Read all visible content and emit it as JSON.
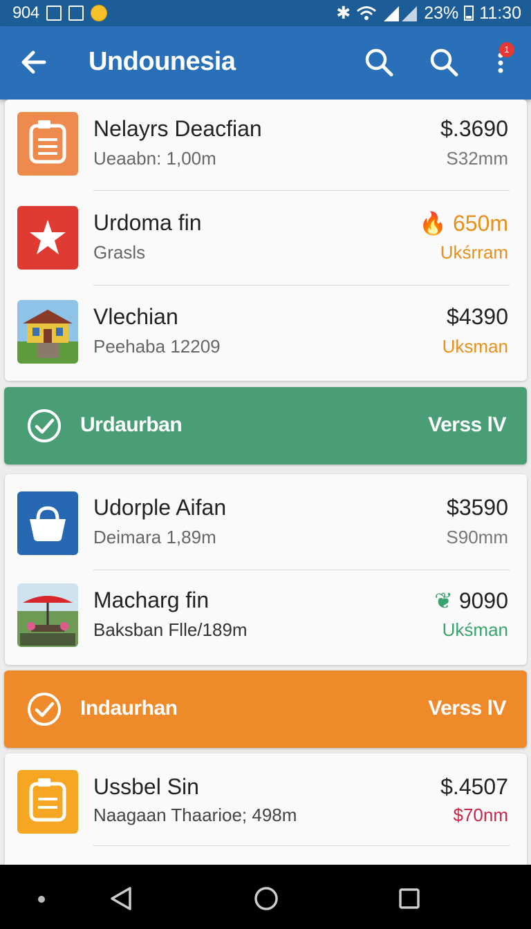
{
  "status_bar": {
    "left_text": "904",
    "battery": "23%",
    "time": "11:30"
  },
  "app_bar": {
    "title": "Undounesia",
    "notification_count": "1"
  },
  "colors": {
    "app_bar": "#2970b9",
    "status_bar": "#1c5c97",
    "green_banner": "#4a9e76",
    "orange_banner": "#ef8a2a",
    "orange_text": "#e9901c",
    "green_text": "#3aa36d",
    "red_text": "#c8274a"
  },
  "group1": {
    "items": [
      {
        "title": "Nelayrs Deacfian",
        "subtitle": "Ueaabn: 1,00m",
        "price": "$.3690",
        "unit": "S32mm",
        "icon": "document-icon"
      },
      {
        "title": "Urdoma fin",
        "subtitle": "Grasls",
        "price": "650m",
        "unit": "Ukśrram",
        "icon": "star-icon"
      },
      {
        "title": "Vlechian",
        "subtitle": "Peehaba 12209",
        "price": "$4390",
        "unit": "Uksman",
        "icon": "house-photo"
      }
    ]
  },
  "banner1": {
    "label": "Urdaurban",
    "action": "Verss lV"
  },
  "group2": {
    "items": [
      {
        "title": "Udorple Aifan",
        "subtitle": "Deimara 1,89m",
        "price": "$3590",
        "unit": "S90mm",
        "icon": "basket-icon"
      },
      {
        "title": "Macharg fin",
        "subtitle": "Baksban Flle/189m",
        "price": "9090",
        "unit": "Ukśman",
        "icon": "patio-photo"
      }
    ]
  },
  "banner2": {
    "label": "Indaurhan",
    "action": "Verss lV"
  },
  "group3": {
    "items": [
      {
        "title": "Ussbel Sin",
        "subtitle": "Naagaan Thaarioe; 498m",
        "price": "$.4507",
        "unit": "$70nm",
        "icon": "document-icon"
      }
    ]
  }
}
